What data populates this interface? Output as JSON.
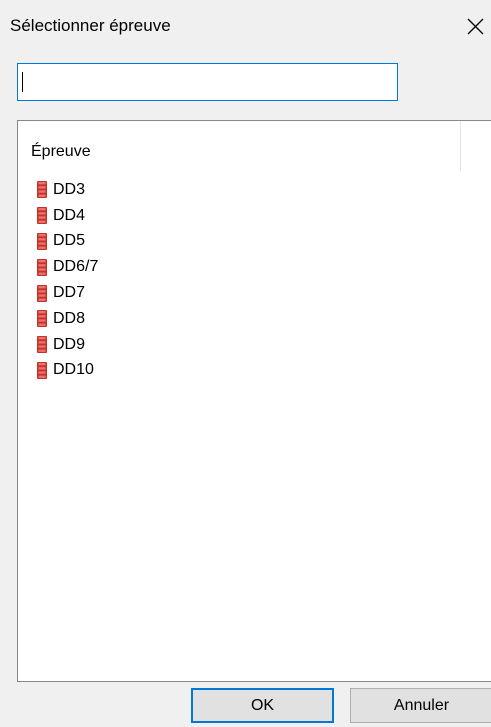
{
  "dialog": {
    "title": "Sélectionner épreuve",
    "close_icon": "close-icon"
  },
  "search": {
    "value": "",
    "placeholder": ""
  },
  "list": {
    "column_header": "Épreuve",
    "item_icon": "database-icon",
    "item_icon_color": "#c8312b",
    "items": [
      {
        "label": "DD3"
      },
      {
        "label": "DD4"
      },
      {
        "label": "DD5"
      },
      {
        "label": "DD6/7"
      },
      {
        "label": "DD7"
      },
      {
        "label": "DD8"
      },
      {
        "label": "DD9"
      },
      {
        "label": "DD10"
      }
    ]
  },
  "buttons": {
    "ok_label": "OK",
    "cancel_label": "Annuler"
  },
  "colors": {
    "accent": "#0078d7",
    "dialog_bg": "#f0f0f0",
    "button_bg": "#e1e1e1"
  }
}
